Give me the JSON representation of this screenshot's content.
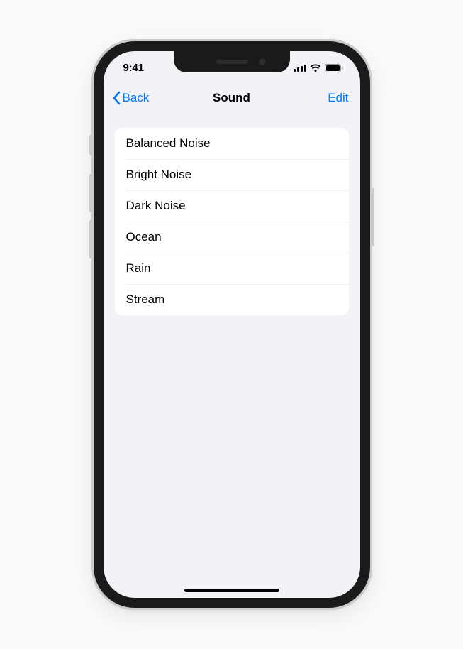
{
  "status": {
    "time": "9:41"
  },
  "nav": {
    "back_label": "Back",
    "title": "Sound",
    "edit_label": "Edit"
  },
  "sounds": [
    {
      "label": "Balanced Noise"
    },
    {
      "label": "Bright Noise"
    },
    {
      "label": "Dark Noise"
    },
    {
      "label": "Ocean"
    },
    {
      "label": "Rain"
    },
    {
      "label": "Stream"
    }
  ],
  "colors": {
    "accent": "#007aff",
    "background": "#f2f2f7",
    "card": "#ffffff"
  }
}
